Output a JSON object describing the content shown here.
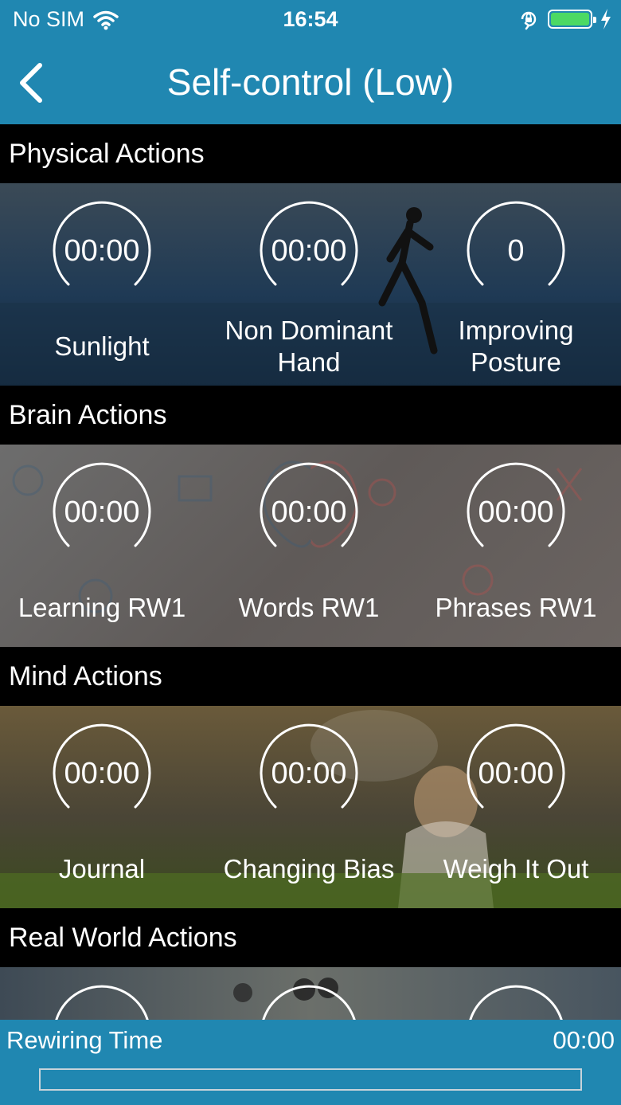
{
  "status": {
    "carrier": "No SIM",
    "time": "16:54",
    "battery_percent": 100
  },
  "nav": {
    "title": "Self-control (Low)"
  },
  "sections": [
    {
      "title": "Physical Actions",
      "actions": [
        {
          "value": "00:00",
          "label": "Sunlight"
        },
        {
          "value": "00:00",
          "label": "Non Dominant Hand"
        },
        {
          "value": "0",
          "label": "Improving Posture"
        }
      ]
    },
    {
      "title": "Brain Actions",
      "actions": [
        {
          "value": "00:00",
          "label": "Learning RW1"
        },
        {
          "value": "00:00",
          "label": "Words RW1"
        },
        {
          "value": "00:00",
          "label": "Phrases RW1"
        }
      ]
    },
    {
      "title": "Mind Actions",
      "actions": [
        {
          "value": "00:00",
          "label": "Journal"
        },
        {
          "value": "00:00",
          "label": "Changing Bias"
        },
        {
          "value": "00:00",
          "label": "Weigh It Out"
        }
      ]
    },
    {
      "title": "Real World Actions"
    }
  ],
  "footer": {
    "label": "Rewiring Time",
    "time": "00:00",
    "progress": 0
  },
  "colors": {
    "accent": "#2087b1",
    "ring": "#ffffff",
    "progress_border": "#c7d3da"
  }
}
